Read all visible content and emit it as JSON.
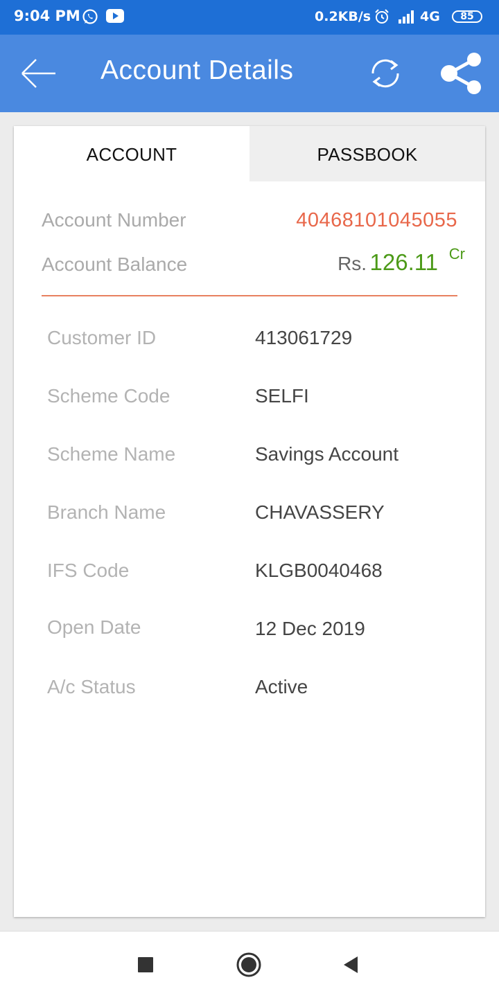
{
  "status_bar": {
    "time": "9:04 PM",
    "net_speed": "0.2KB/s",
    "network": "4G",
    "battery": "85",
    "icons": [
      "whatsapp-icon",
      "youtube-icon",
      "alarm-icon",
      "signal-icon",
      "battery-icon"
    ]
  },
  "app_bar": {
    "title": "Account Details",
    "icons": [
      "back-arrow-icon",
      "refresh-icon",
      "share-icon"
    ],
    "color": "#4a89e0"
  },
  "tabs": [
    {
      "label": "ACCOUNT",
      "selected": true
    },
    {
      "label": "PASSBOOK",
      "selected": false
    }
  ],
  "summary": {
    "account_number_label": "Account Number",
    "account_number": "40468101045055",
    "balance_label": "Account Balance",
    "currency": "Rs.",
    "balance": "126.11",
    "balance_type": "Cr"
  },
  "details": [
    {
      "label": "Customer ID",
      "value": "413061729"
    },
    {
      "label": "Scheme Code",
      "value": "SELFI"
    },
    {
      "label": "Scheme Name",
      "value": "Savings Account"
    },
    {
      "label": "Branch Name",
      "value": "CHAVASSERY"
    },
    {
      "label": "IFS Code",
      "value": "KLGB0040468"
    },
    {
      "label": "Open Date",
      "value": "12 Dec 2019"
    },
    {
      "label": "A/c Status",
      "value": "Active"
    }
  ],
  "colors": {
    "status_bar": "#1e6fd6",
    "account_number": "#e8674a",
    "balance": "#4c9a18",
    "divider": "#e8805e"
  },
  "nav_bar": {
    "icons": [
      "recent-apps-icon",
      "home-icon",
      "back-icon"
    ]
  }
}
